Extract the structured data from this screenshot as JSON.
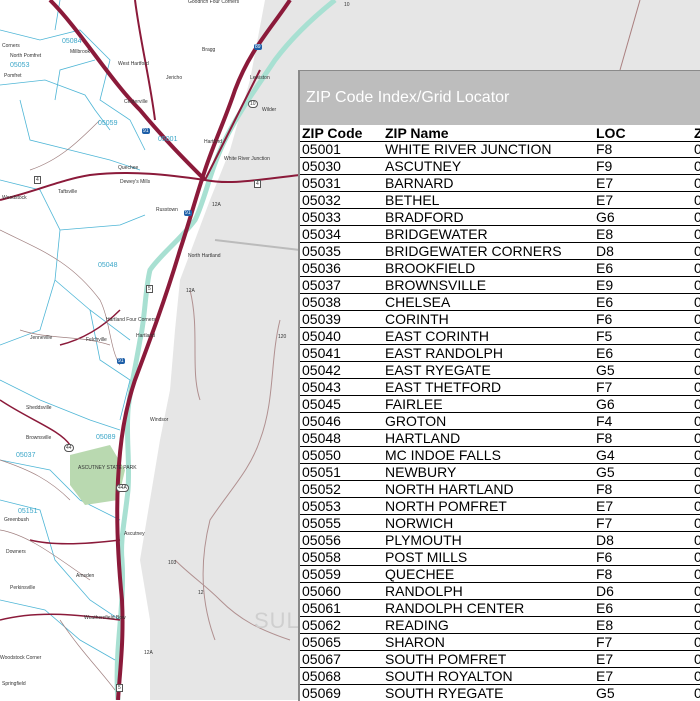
{
  "map": {
    "region_label": "SULLIVAN",
    "region_label_visible": "SU",
    "zip_labels": [
      {
        "text": "05084",
        "id": "zip-05084"
      },
      {
        "text": "05053",
        "id": "zip-05053"
      },
      {
        "text": "05059",
        "id": "zip-05059"
      },
      {
        "text": "05001",
        "id": "zip-05001"
      },
      {
        "text": "05048",
        "id": "zip-05048"
      },
      {
        "text": "05089",
        "id": "zip-05089"
      },
      {
        "text": "05037",
        "id": "zip-05037"
      },
      {
        "text": "05151",
        "id": "zip-05151"
      }
    ],
    "town_labels": [
      {
        "text": "Goodrich Four Corners"
      },
      {
        "text": "Corners"
      },
      {
        "text": "North Pomfret"
      },
      {
        "text": "Pomfret"
      },
      {
        "text": "Millbrook"
      },
      {
        "text": "West Hartford"
      },
      {
        "text": "Bragg"
      },
      {
        "text": "Jericho"
      },
      {
        "text": "Lewiston"
      },
      {
        "text": "Centerville"
      },
      {
        "text": "Hartford"
      },
      {
        "text": "White River Junction"
      },
      {
        "text": "Quechee"
      },
      {
        "text": "Dewey's Mills"
      },
      {
        "text": "Taftsville"
      },
      {
        "text": "Woodstock"
      },
      {
        "text": "Russtown"
      },
      {
        "text": "Wilder"
      },
      {
        "text": "North Hartland"
      },
      {
        "text": "Hartland Four Corners"
      },
      {
        "text": "Hartland"
      },
      {
        "text": "Jenneville"
      },
      {
        "text": "Felchville"
      },
      {
        "text": "Sheddsville"
      },
      {
        "text": "Brownsville"
      },
      {
        "text": "Windsor"
      },
      {
        "text": "ASCUTNEY STATE PARK"
      },
      {
        "text": "Greenbush"
      },
      {
        "text": "Downers"
      },
      {
        "text": "Ascutney"
      },
      {
        "text": "Perkinsville"
      },
      {
        "text": "Weathersfield Bow"
      },
      {
        "text": "Amsden"
      },
      {
        "text": "Springfield"
      },
      {
        "text": "Woodstock Corner"
      }
    ],
    "route_shields": [
      "89",
      "91",
      "91",
      "91",
      "4",
      "4",
      "10",
      "12",
      "12A",
      "12A",
      "120",
      "120",
      "103",
      "106",
      "5",
      "5",
      "5",
      "5",
      "44",
      "44A",
      "131",
      "12",
      "12A",
      "10"
    ]
  },
  "index": {
    "title": "ZIP Code Index/Grid Locator",
    "headers": {
      "zip": "ZIP Code",
      "name": "ZIP Name",
      "loc": "LOC",
      "extra": "Z"
    },
    "rows": [
      {
        "zip": "05001",
        "name": "WHITE RIVER JUNCTION",
        "loc": "F8",
        "extra": "0"
      },
      {
        "zip": "05030",
        "name": "ASCUTNEY",
        "loc": "F9",
        "extra": "0"
      },
      {
        "zip": "05031",
        "name": "BARNARD",
        "loc": "E7",
        "extra": "0"
      },
      {
        "zip": "05032",
        "name": "BETHEL",
        "loc": "E7",
        "extra": "0"
      },
      {
        "zip": "05033",
        "name": "BRADFORD",
        "loc": "G6",
        "extra": "0"
      },
      {
        "zip": "05034",
        "name": "BRIDGEWATER",
        "loc": "E8",
        "extra": "0"
      },
      {
        "zip": "05035",
        "name": "BRIDGEWATER CORNERS",
        "loc": "D8",
        "extra": "0"
      },
      {
        "zip": "05036",
        "name": "BROOKFIELD",
        "loc": "E6",
        "extra": "0"
      },
      {
        "zip": "05037",
        "name": "BROWNSVILLE",
        "loc": "E9",
        "extra": "0"
      },
      {
        "zip": "05038",
        "name": "CHELSEA",
        "loc": "E6",
        "extra": "0"
      },
      {
        "zip": "05039",
        "name": "CORINTH",
        "loc": "F6",
        "extra": "0"
      },
      {
        "zip": "05040",
        "name": "EAST CORINTH",
        "loc": "F5",
        "extra": "0"
      },
      {
        "zip": "05041",
        "name": "EAST RANDOLPH",
        "loc": "E6",
        "extra": "0"
      },
      {
        "zip": "05042",
        "name": "EAST RYEGATE",
        "loc": "G5",
        "extra": "0"
      },
      {
        "zip": "05043",
        "name": "EAST THETFORD",
        "loc": "F7",
        "extra": "0"
      },
      {
        "zip": "05045",
        "name": "FAIRLEE",
        "loc": "G6",
        "extra": "0"
      },
      {
        "zip": "05046",
        "name": "GROTON",
        "loc": "F4",
        "extra": "0"
      },
      {
        "zip": "05048",
        "name": "HARTLAND",
        "loc": "F8",
        "extra": "0"
      },
      {
        "zip": "05050",
        "name": "MC INDOE FALLS",
        "loc": "G4",
        "extra": "0"
      },
      {
        "zip": "05051",
        "name": "NEWBURY",
        "loc": "G5",
        "extra": "0"
      },
      {
        "zip": "05052",
        "name": "NORTH HARTLAND",
        "loc": "F8",
        "extra": "0"
      },
      {
        "zip": "05053",
        "name": "NORTH POMFRET",
        "loc": "E7",
        "extra": "0"
      },
      {
        "zip": "05055",
        "name": "NORWICH",
        "loc": "F7",
        "extra": "0"
      },
      {
        "zip": "05056",
        "name": "PLYMOUTH",
        "loc": "D8",
        "extra": "0"
      },
      {
        "zip": "05058",
        "name": "POST MILLS",
        "loc": "F6",
        "extra": "0"
      },
      {
        "zip": "05059",
        "name": "QUECHEE",
        "loc": "F8",
        "extra": "0"
      },
      {
        "zip": "05060",
        "name": "RANDOLPH",
        "loc": "D6",
        "extra": "0"
      },
      {
        "zip": "05061",
        "name": "RANDOLPH CENTER",
        "loc": "E6",
        "extra": "0"
      },
      {
        "zip": "05062",
        "name": "READING",
        "loc": "E8",
        "extra": "0"
      },
      {
        "zip": "05065",
        "name": "SHARON",
        "loc": "F7",
        "extra": "0"
      },
      {
        "zip": "05067",
        "name": "SOUTH POMFRET",
        "loc": "E7",
        "extra": "0"
      },
      {
        "zip": "05068",
        "name": "SOUTH ROYALTON",
        "loc": "E7",
        "extra": "0"
      },
      {
        "zip": "05069",
        "name": "SOUTH RYEGATE",
        "loc": "G5",
        "extra": "0"
      }
    ]
  },
  "colors": {
    "nh_land": "#e6e6e6",
    "vt_land": "#ffffff",
    "river": "#a8e0d2",
    "highway": "#8b1a3a",
    "zip_boundary": "#4fb6d6",
    "zip_text": "#3aa6c8",
    "panel_header": "#bdbdbd",
    "state_park": "#b9d9b0"
  },
  "icons": {
    "interstate": "interstate-shield-icon",
    "us_route": "us-route-shield-icon",
    "state_route": "state-route-oval-icon"
  }
}
